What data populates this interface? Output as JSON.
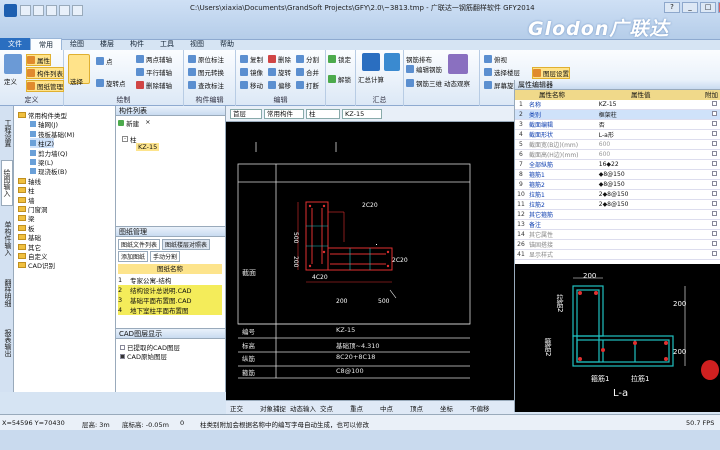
{
  "window": {
    "title": "C:\\Users\\xiaxia\\Documents\\GrandSoft Projects\\GFY\\2.0\\~3813.tmp - 广联达一钢筋翻样软件 GFY2014",
    "brand": "Glodon广联达",
    "controls": [
      "?",
      "_",
      "□",
      "×"
    ]
  },
  "ribbon": {
    "tabs": [
      "文件",
      "常用",
      "绘图",
      "楼层",
      "构件",
      "工具",
      "视图",
      "帮助"
    ],
    "active_tab": "常用",
    "groups": [
      {
        "name": "定义",
        "items": [
          "定义",
          "属性",
          "构件列表",
          "图纸管理"
        ]
      },
      {
        "name": "绘制",
        "items": [
          "选择",
          "点",
          "旋转点",
          "两点辅轴",
          "平行辅轴",
          "删除辅轴"
        ]
      },
      {
        "name": "构件编辑",
        "items": [
          "原位标注",
          "图元转换",
          "查改标注"
        ]
      },
      {
        "name": "编辑",
        "items": [
          "复制",
          "镜像",
          "移动",
          "删除",
          "旋转",
          "偏移",
          "分割",
          "合并",
          "打断",
          "锁定",
          "解锁"
        ]
      },
      {
        "name": "汇总",
        "items": [
          "汇总计算",
          "钢筋排布"
        ]
      },
      {
        "name": "",
        "items": [
          "编辑钢筋",
          "钢筋三维",
          "动态观察"
        ]
      },
      {
        "name": "视图",
        "items": [
          "俯视",
          "选择楼层",
          "屏幕旋转",
          "图层设置"
        ]
      }
    ]
  },
  "left_tabs": [
    "工程设置",
    "绘图输入",
    "单构件输入",
    "翻样明细",
    "报表输出"
  ],
  "tree": {
    "header": "",
    "items": [
      {
        "label": "常用构件类型",
        "level": 0,
        "type": "folder"
      },
      {
        "label": "轴网(J)",
        "level": 1,
        "type": "leaf"
      },
      {
        "label": "筏板基础(M)",
        "level": 1,
        "type": "leaf"
      },
      {
        "label": "柱(Z)",
        "level": 1,
        "type": "leaf",
        "selected": true
      },
      {
        "label": "剪力墙(Q)",
        "level": 1,
        "type": "leaf"
      },
      {
        "label": "梁(L)",
        "level": 1,
        "type": "leaf"
      },
      {
        "label": "现浇板(B)",
        "level": 1,
        "type": "leaf"
      },
      {
        "label": "轴线",
        "level": 0,
        "type": "folder"
      },
      {
        "label": "柱",
        "level": 0,
        "type": "folder"
      },
      {
        "label": "墙",
        "level": 0,
        "type": "folder"
      },
      {
        "label": "门窗洞",
        "level": 0,
        "type": "folder"
      },
      {
        "label": "梁",
        "level": 0,
        "type": "folder"
      },
      {
        "label": "板",
        "level": 0,
        "type": "folder"
      },
      {
        "label": "基础",
        "level": 0,
        "type": "folder"
      },
      {
        "label": "其它",
        "level": 0,
        "type": "folder"
      },
      {
        "label": "自定义",
        "level": 0,
        "type": "folder"
      },
      {
        "label": "CAD识别",
        "level": 0,
        "type": "folder"
      }
    ]
  },
  "component_list": {
    "title": "构件列表",
    "toolbar": [
      "新建",
      "×"
    ],
    "root": "柱",
    "items": [
      "KZ-15"
    ]
  },
  "drawing_mgr": {
    "title": "图纸管理",
    "tabs": [
      "图纸文件列表",
      "图纸楼层对照表"
    ],
    "buttons": [
      "添加图纸",
      "手动分割"
    ],
    "col_header": "图纸名称",
    "rows": [
      {
        "num": "1",
        "name": "专家公寓-结构"
      },
      {
        "num": "2",
        "name": "结构设计总说明.CAD"
      },
      {
        "num": "3",
        "name": "基础平面布置图.CAD"
      },
      {
        "num": "4",
        "name": "地下室柱平面布置图"
      }
    ]
  },
  "cad_layer": {
    "title": "CAD图层显示",
    "items": [
      "已提取的CAD图层",
      "CAD原始图层"
    ]
  },
  "cad_toolbar": {
    "floor": "首层",
    "category": "常用构件",
    "type": "柱",
    "component": "KZ-15"
  },
  "canvas": {
    "label_section": "截面",
    "dims": [
      "2C20",
      "2C20",
      "4C20",
      "500",
      "200",
      "200",
      "500"
    ],
    "table_rows": [
      {
        "key": "编号",
        "value": "KZ-15"
      },
      {
        "key": "标高",
        "value": "基础顶~4.310"
      },
      {
        "key": "纵筋",
        "value": "8C20+8C18"
      },
      {
        "key": "箍筋",
        "value": "C8@100"
      }
    ]
  },
  "snap_bar": [
    "正交",
    "对象捕捉",
    "动态输入",
    "交点",
    "重点",
    "中点",
    "顶点",
    "坐标",
    "不偏移"
  ],
  "properties": {
    "title": "属性编辑器",
    "col_name": "属性名称",
    "col_value": "属性值",
    "col_extra": "附加",
    "rows": [
      {
        "num": "1",
        "name": "名称",
        "value": "KZ-15",
        "gray": false
      },
      {
        "num": "2",
        "name": "类别",
        "value": "框架柱",
        "gray": false,
        "selected": true
      },
      {
        "num": "3",
        "name": "截面编辑",
        "value": "否",
        "gray": false
      },
      {
        "num": "4",
        "name": "截面形状",
        "value": "L-a形",
        "gray": false
      },
      {
        "num": "5",
        "name": "截面宽(B边)(mm)",
        "value": "600",
        "gray": true
      },
      {
        "num": "6",
        "name": "截面高(H边)(mm)",
        "value": "600",
        "gray": true
      },
      {
        "num": "7",
        "name": "全部纵筋",
        "value": "16◆22",
        "gray": false
      },
      {
        "num": "8",
        "name": "箍筋1",
        "value": "◆8@150",
        "gray": false
      },
      {
        "num": "9",
        "name": "箍筋2",
        "value": "◆8@150",
        "gray": false
      },
      {
        "num": "10",
        "name": "拉筋1",
        "value": "2◆8@150",
        "gray": false
      },
      {
        "num": "11",
        "name": "拉筋2",
        "value": "2◆8@150",
        "gray": false
      },
      {
        "num": "12",
        "name": "其它箍筋",
        "value": "",
        "gray": false
      },
      {
        "num": "13",
        "name": "备注",
        "value": "",
        "gray": false
      },
      {
        "num": "14",
        "name": "其它属性",
        "value": "",
        "gray": true
      },
      {
        "num": "26",
        "name": "锚固搭接",
        "value": "",
        "gray": true
      },
      {
        "num": "41",
        "name": "显示样式",
        "value": "",
        "gray": true
      }
    ]
  },
  "preview": {
    "dims_top": "200",
    "dims_right": [
      "200",
      "200"
    ],
    "labels": [
      "拉筋2",
      "箍筋2",
      "箍筋1",
      "拉筋1"
    ],
    "shape_name": "L-a"
  },
  "status": {
    "coords": "X=54596 Y=70430",
    "floor_height": "层高: 3m",
    "base_elev": "底标高: -0.05m",
    "zero": "0",
    "hint": "柱类别附加会根据名称中的编写字母自动生成，也可以修改",
    "fps": "50.7 FPS"
  },
  "colors": {
    "accent": "#2a6ec0",
    "canvas_bg": "#000000",
    "red_rebar": "#e03030",
    "cyan_rebar": "#20c0c0",
    "selection": "#ffe38a"
  }
}
